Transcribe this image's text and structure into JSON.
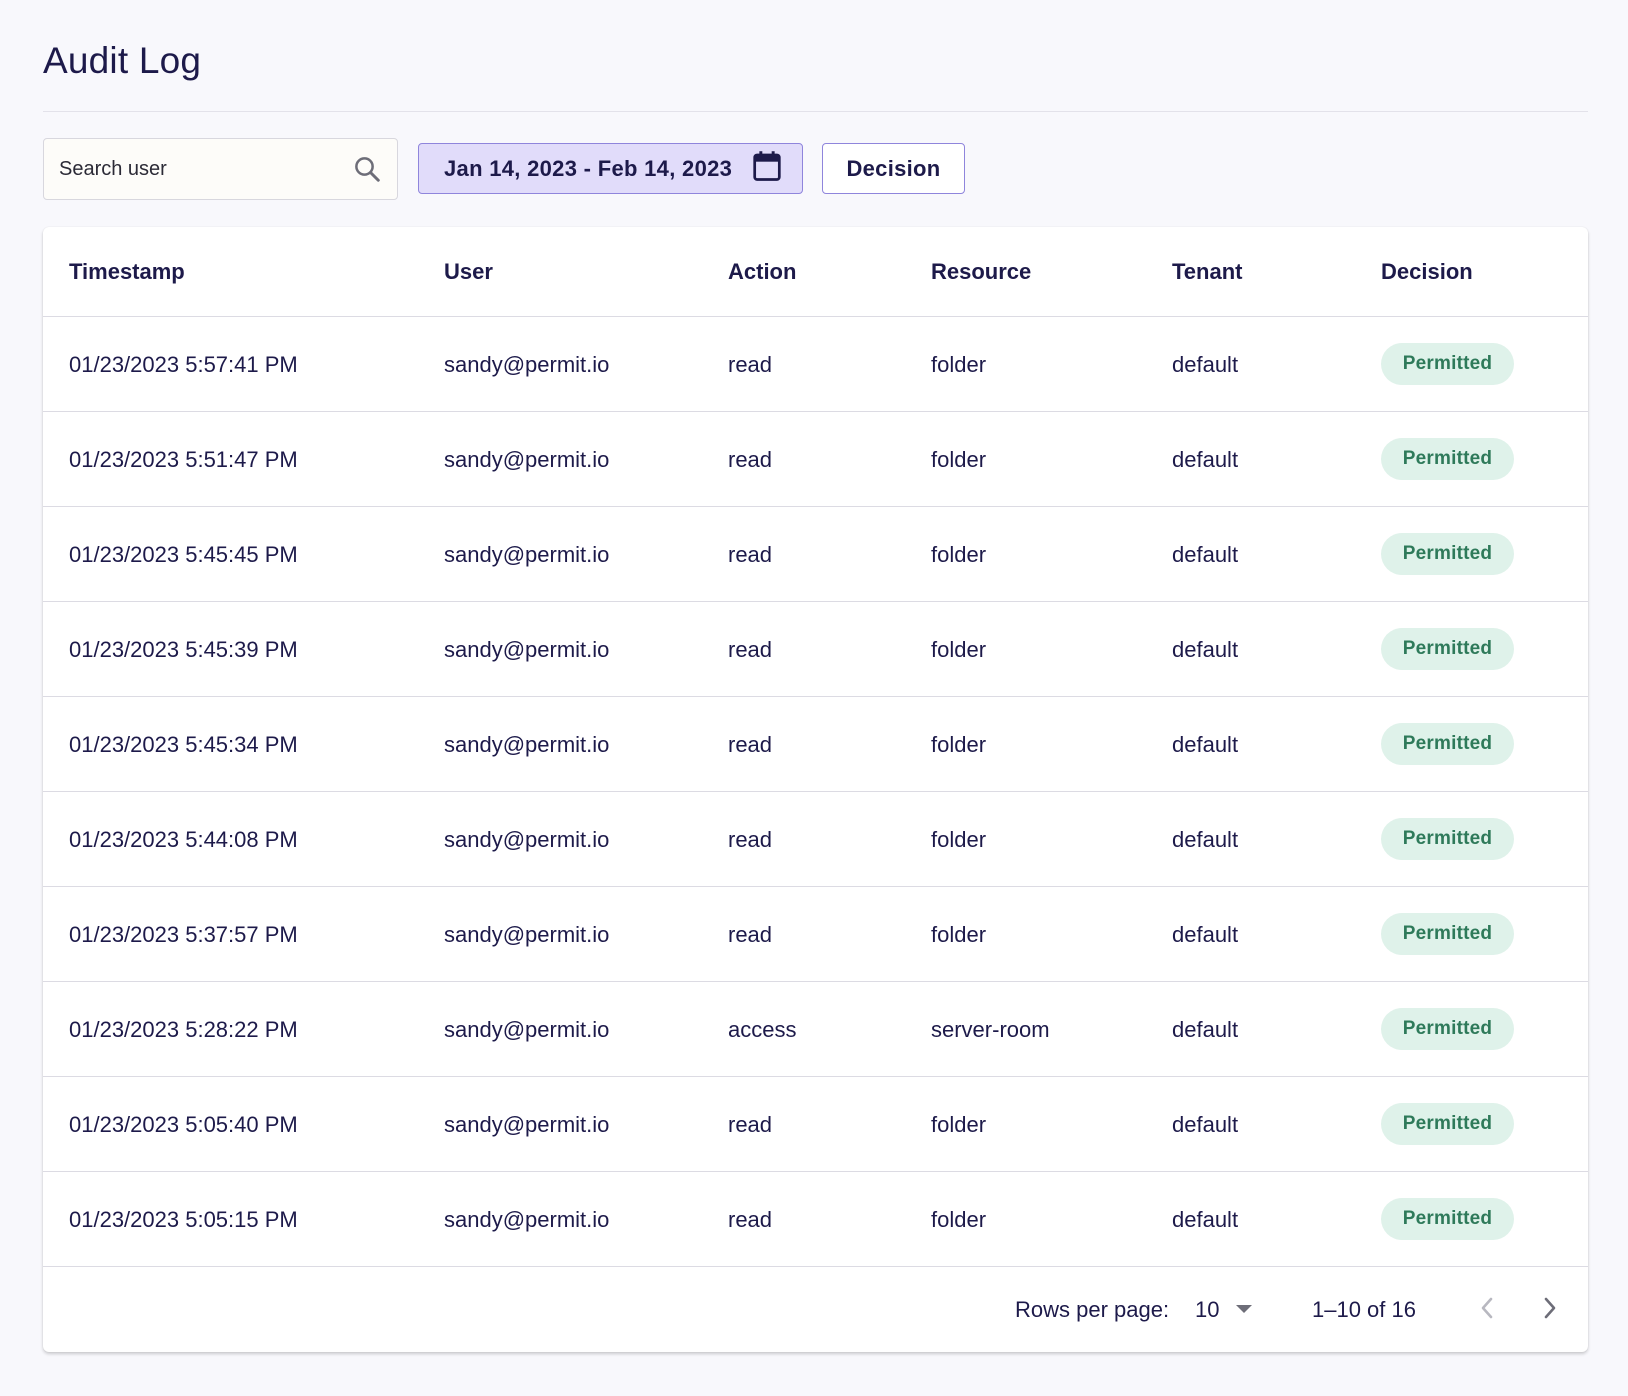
{
  "page": {
    "title": "Audit Log"
  },
  "filters": {
    "search_placeholder": "Search user",
    "search_value": "",
    "date_range": "Jan 14, 2023 - Feb 14, 2023",
    "decision_label": "Decision"
  },
  "table": {
    "columns": [
      "Timestamp",
      "User",
      "Action",
      "Resource",
      "Tenant",
      "Decision"
    ],
    "rows": [
      {
        "timestamp": "01/23/2023 5:57:41 PM",
        "user": "sandy@permit.io",
        "action": "read",
        "resource": "folder",
        "tenant": "default",
        "decision": "Permitted"
      },
      {
        "timestamp": "01/23/2023 5:51:47 PM",
        "user": "sandy@permit.io",
        "action": "read",
        "resource": "folder",
        "tenant": "default",
        "decision": "Permitted"
      },
      {
        "timestamp": "01/23/2023 5:45:45 PM",
        "user": "sandy@permit.io",
        "action": "read",
        "resource": "folder",
        "tenant": "default",
        "decision": "Permitted"
      },
      {
        "timestamp": "01/23/2023 5:45:39 PM",
        "user": "sandy@permit.io",
        "action": "read",
        "resource": "folder",
        "tenant": "default",
        "decision": "Permitted"
      },
      {
        "timestamp": "01/23/2023 5:45:34 PM",
        "user": "sandy@permit.io",
        "action": "read",
        "resource": "folder",
        "tenant": "default",
        "decision": "Permitted"
      },
      {
        "timestamp": "01/23/2023 5:44:08 PM",
        "user": "sandy@permit.io",
        "action": "read",
        "resource": "folder",
        "tenant": "default",
        "decision": "Permitted"
      },
      {
        "timestamp": "01/23/2023 5:37:57 PM",
        "user": "sandy@permit.io",
        "action": "read",
        "resource": "folder",
        "tenant": "default",
        "decision": "Permitted"
      },
      {
        "timestamp": "01/23/2023 5:28:22 PM",
        "user": "sandy@permit.io",
        "action": "access",
        "resource": "server-room",
        "tenant": "default",
        "decision": "Permitted"
      },
      {
        "timestamp": "01/23/2023 5:05:40 PM",
        "user": "sandy@permit.io",
        "action": "read",
        "resource": "folder",
        "tenant": "default",
        "decision": "Permitted"
      },
      {
        "timestamp": "01/23/2023 5:05:15 PM",
        "user": "sandy@permit.io",
        "action": "read",
        "resource": "folder",
        "tenant": "default",
        "decision": "Permitted"
      }
    ]
  },
  "pagination": {
    "rows_per_page_label": "Rows per page:",
    "rows_per_page_value": "10",
    "range_text": "1–10 of 16"
  },
  "icons": {
    "search": "search-icon",
    "calendar": "calendar-icon",
    "dropdown": "caret-down-icon",
    "prev": "chevron-left-icon",
    "next": "chevron-right-icon"
  },
  "colors": {
    "background": "#f8f8fc",
    "text": "#1d1a4a",
    "date_button_bg": "#e1dcfa",
    "accent_border": "#8f85dc",
    "permitted_badge_bg": "#dff2ea",
    "permitted_badge_text": "#2e7a5a"
  }
}
